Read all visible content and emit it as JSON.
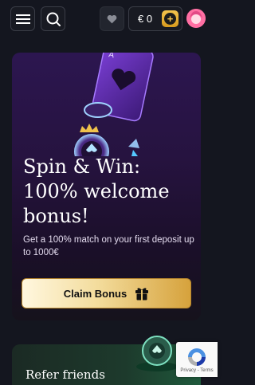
{
  "header": {
    "balance": "€ 0",
    "plus_symbol": "+"
  },
  "promo": {
    "title_line1": "Spin & Win:",
    "title_line2": "100% welcome",
    "title_line3": "bonus!",
    "description": "Get a 100% match on your first deposit up to 1000€",
    "claim_label": "Claim Bonus"
  },
  "refer": {
    "title": "Refer friends"
  },
  "recaptcha": {
    "footer": "Privacy - Terms"
  },
  "colors": {
    "background": "#14161f",
    "accent_gold": "#f3c44e",
    "promo_purple": "#2c1650",
    "refer_green": "#1f5a3c"
  },
  "icons": [
    "menu-icon",
    "search-icon",
    "heart-icon",
    "plus-icon",
    "avatar",
    "gift-icon",
    "poker-chip-icon",
    "recaptcha-icon"
  ]
}
